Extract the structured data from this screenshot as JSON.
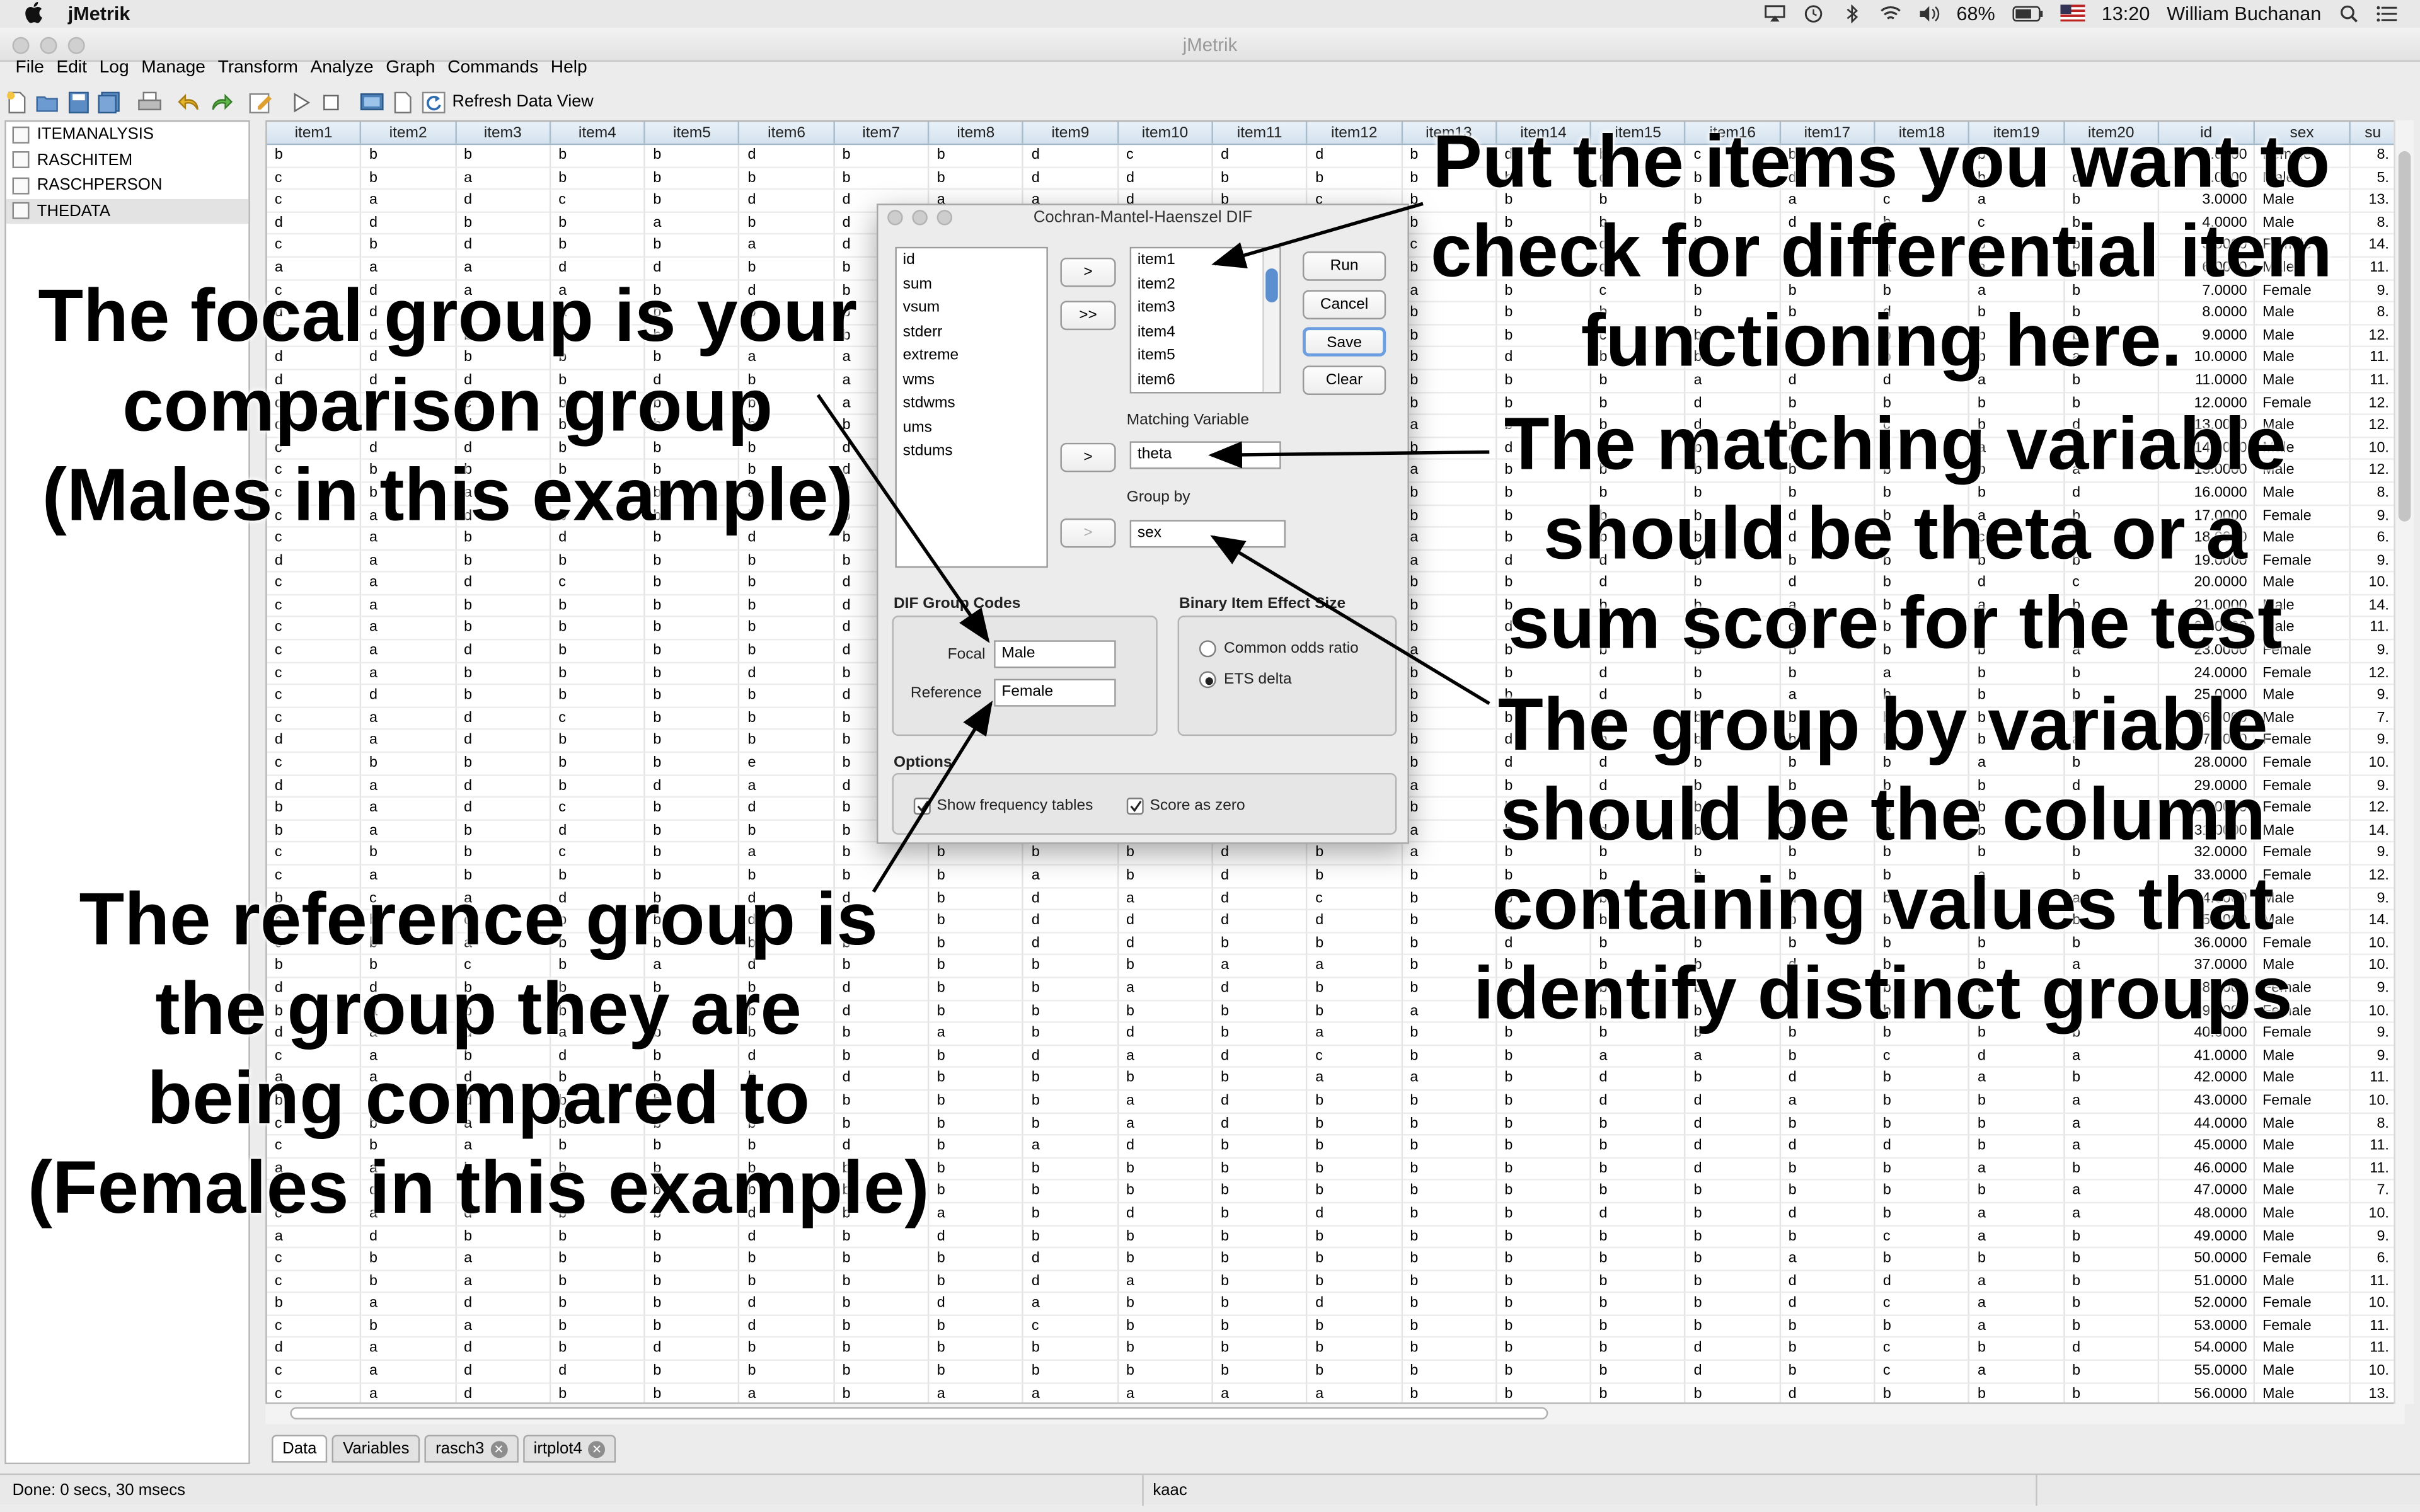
{
  "menubar": {
    "app_name": "jMetrik",
    "battery": "68%",
    "time": "13:20",
    "user": "William Buchanan"
  },
  "window": {
    "title": "jMetrik"
  },
  "app_menu": [
    "File",
    "Edit",
    "Log",
    "Manage",
    "Transform",
    "Analyze",
    "Graph",
    "Commands",
    "Help"
  ],
  "toolbar": {
    "refresh_label": "Refresh Data View"
  },
  "tree": [
    "ITEMANALYSIS",
    "RASCHITEM",
    "RASCHPERSON",
    "THEDATA"
  ],
  "grid": {
    "columns": [
      "item1",
      "item2",
      "item3",
      "item4",
      "item5",
      "item6",
      "item7",
      "item8",
      "item9",
      "item10",
      "item11",
      "item12",
      "item13",
      "item14",
      "item15",
      "item16",
      "item17",
      "item18",
      "item19",
      "item20",
      "id",
      "sex",
      "su"
    ],
    "ids": [
      "1.0000",
      "2.0000",
      "3.0000",
      "4.0000",
      "5.0000",
      "6.0000",
      "7.0000",
      "8.0000",
      "9.0000",
      "10.0000",
      "11.0000",
      "12.0000",
      "13.0000",
      "14.0000",
      "15.0000",
      "16.0000",
      "17.0000",
      "18.0000",
      "19.0000",
      "20.0000",
      "21.0000",
      "22.0000",
      "23.0000",
      "24.0000",
      "25.0000",
      "26.0000",
      "27.0000",
      "28.0000",
      "29.0000",
      "30.0000",
      "31.0000",
      "32.0000",
      "33.0000",
      "34.0000",
      "35.0000",
      "36.0000",
      "37.0000",
      "38.0000",
      "39.0000",
      "40.0000",
      "41.0000",
      "42.0000",
      "43.0000",
      "44.0000",
      "45.0000",
      "46.0000",
      "47.0000",
      "48.0000",
      "49.0000",
      "50.0000",
      "51.0000",
      "52.0000",
      "53.0000",
      "54.0000",
      "55.0000",
      "56.0000"
    ],
    "sex": [
      "Female",
      "Male",
      "Male",
      "Male",
      "Female",
      "Male",
      "Female",
      "Male",
      "Male",
      "Male",
      "Male",
      "Female",
      "Male",
      "Male",
      "Male",
      "Male",
      "Female",
      "Male",
      "Female",
      "Male",
      "Male",
      "Male",
      "Female",
      "Female",
      "Male",
      "Male",
      "Female",
      "Female",
      "Female",
      "Female",
      "Male",
      "Female",
      "Female",
      "Male",
      "Male",
      "Female",
      "Male",
      "Female",
      "Female",
      "Female",
      "Male",
      "Male",
      "Female",
      "Male",
      "Male",
      "Male",
      "Male",
      "Male",
      "Male",
      "Female",
      "Male",
      "Female",
      "Female",
      "Male",
      "Male",
      "Male"
    ],
    "su": [
      "8.",
      "5.",
      "13.",
      "8.",
      "14.",
      "11.",
      "9.",
      "8.",
      "12.",
      "11.",
      "11.",
      "12.",
      "12.",
      "10.",
      "12.",
      "8.",
      "9.",
      "6.",
      "9.",
      "10.",
      "14.",
      "11.",
      "9.",
      "12.",
      "9.",
      "7.",
      "9.",
      "10.",
      "9.",
      "12.",
      "14.",
      "9.",
      "12.",
      "9.",
      "14.",
      "10.",
      "10.",
      "9.",
      "10.",
      "9.",
      "9.",
      "11.",
      "10.",
      "8.",
      "11.",
      "11.",
      "7.",
      "10.",
      "9.",
      "6.",
      "11.",
      "10.",
      "11.",
      "11.",
      "10.",
      "13."
    ],
    "row_letters": [
      "bbbbbdbbdcddb",
      "cbabbbbbddbbb",
      "cadcbddaadbcb",
      "ddbbabdbddbbb",
      "cbdbbadbadadc",
      "aaaddbbaaadbb",
      "cdaabdbbbbdba",
      "ddcabbbabbdbb",
      "cdbdbdbadbbdb",
      "ddbbbaabddbab",
      "dddbdbaaddbab",
      "cdcbbbadbdabb",
      "cbdbbbbbddbba",
      "cddbbbddadbbb",
      "cbbbbbddbdbda",
      "cbabbadabbbbb",
      "cadbbbbadabab",
      "cabdbdbbddbba",
      "dabbbbbcbcdba",
      "cadcbbddbbdbb",
      "cabbbbddbbdbb",
      "cabbbbdaabbbb",
      "cadbbbdbdbbba",
      "cabbbdbbbbdbb",
      "cdbbbbdabdbab",
      "cadcbbbbbbbcb",
      "dadbbbbbbbabb",
      "cbbbbebabbbcb",
      "dadbdadbabbda",
      "badcbdbbbbaab",
      "babdbbbbbbdba",
      "cbbcbabbbbdba",
      "cabbbbbbabdbb",
      "bcadbddbdadcb",
      "cbcbbddbddddb",
      "cbabbbbbddbbb",
      "bbcbadbbbbaab",
      "ddbbbbdbbadbb",
      "babbdbdbbbbba",
      "dadabbbabdbab",
      "cabdbdbbdadcb",
      "aadbbbdbbbbaa",
      "badbbbbbbadbb",
      "cbabbbbbbadbb",
      "cbabbbdbadbbb",
      "aabbbbbbbbbbb",
      "cdbbbbbbbbbbb",
      "cadbbdbabdbdb",
      "adbbbdbdbbbbb",
      "cbabbbbbdbbbb",
      "cbabbbbbdabbb",
      "badbbdbdabbdb",
      "cbabbdbbcbbbb",
      "dadbdbbbbbbbb",
      "caddbbbbbbbbb",
      "cadbbabaaaaab"
    ],
    "row_letters_right": [
      "dbcbbbd",
      "bdbdbbd",
      "bbbacab",
      "bbbdbcb",
      "bdbdbbb",
      "ddbdaab",
      "bcbbbab",
      "bbbbdbb",
      "bcbdbbb",
      "dbbbbba",
      "bbaddab",
      "bbdbbbb",
      "bbdbcbd",
      "ddbcbab",
      "bbbbbba",
      "bbbbbbd",
      "bbbdbab",
      "bbbdbcb",
      "ddbbbbb",
      "bdbdbdc",
      "bbbabab",
      "dddcbbb",
      "bbbbbba",
      "bdbbabb",
      "bdbabbb",
      "bbbbbbb",
      "dbbbbba",
      "ddbbbab",
      "bdbbbbd",
      "bbbcbbb",
      "bdbdbbb",
      "bbbbbbb",
      "bbbbbab",
      "bbbdbba",
      "bbbbbbb",
      "dbbbbbb",
      "bbbdbba",
      "bbbbbab",
      "bbbbbbb",
      "bbbbbbb",
      "baabcda",
      "bdbdbab",
      "bddabba",
      "bbdbbba",
      "bbdddba",
      "bbdbbab",
      "bbbbbba",
      "bdbdbaa",
      "bbbbcab",
      "bbbabbb",
      "bbbddab",
      "bbbdcab",
      "bbbbbab",
      "bbdbcbd",
      "bbdbcab",
      "bbbdbbb"
    ]
  },
  "tabs": [
    {
      "label": "Data",
      "closable": false
    },
    {
      "label": "Variables",
      "closable": false
    },
    {
      "label": "rasch3",
      "closable": true
    },
    {
      "label": "irtplot4",
      "closable": true
    }
  ],
  "status": {
    "left": "Done: 0 secs, 30 msecs",
    "middle": "kaac"
  },
  "dialog": {
    "title": "Cochran-Mantel-Haenszel DIF",
    "source_vars": [
      "id",
      "sum",
      "vsum",
      "stderr",
      "extreme",
      "wms",
      "stdwms",
      "ums",
      "stdums"
    ],
    "move_one": ">",
    "move_all": ">>",
    "selected_items": [
      "item1",
      "item2",
      "item3",
      "item4",
      "item5",
      "item6"
    ],
    "buttons": {
      "run": "Run",
      "cancel": "Cancel",
      "save": "Save",
      "clear": "Clear"
    },
    "matching_label": "Matching Variable",
    "matching_value": "theta",
    "groupby_label": "Group by",
    "groupby_value": "sex",
    "codes_title": "DIF Group Codes",
    "focal_label": "Focal",
    "focal_value": "Male",
    "reference_label": "Reference",
    "reference_value": "Female",
    "effect_title": "Binary Item Effect Size",
    "effect_options": [
      "Common odds ratio",
      "ETS delta"
    ],
    "effect_selected": "ETS delta",
    "options_title": "Options",
    "show_freq": "Show frequency tables",
    "score_zero": "Score as zero"
  },
  "annotations": {
    "focal": [
      "The focal group is your",
      "comparison group",
      "(Males in this example)"
    ],
    "reference": [
      "The reference group is",
      "the group they are",
      "being compared to",
      "(Females in this example)"
    ],
    "items": [
      "Put the items you want to",
      "check for differential item",
      "functioning here."
    ],
    "matching": [
      "The matching variable",
      "should be theta or a",
      "sum score for the test"
    ],
    "groupby": [
      "The group by variable",
      "should be the column",
      "containing values that",
      "identify distinct groups"
    ]
  }
}
